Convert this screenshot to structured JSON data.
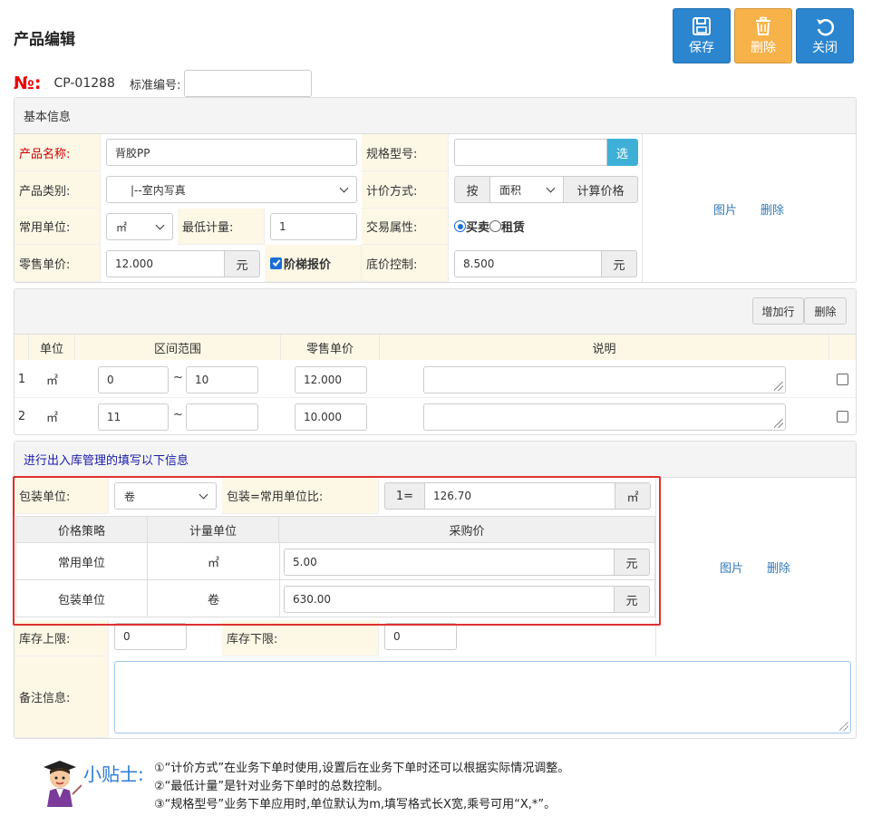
{
  "page": {
    "title": "产品编辑"
  },
  "toolbar": {
    "save": "保存",
    "delete": "删除",
    "close": "关闭",
    "colors": {
      "save": "#2b85cf",
      "delete": "#f7b24a",
      "close": "#2b85cf"
    }
  },
  "header": {
    "no_symbol": "№:",
    "no_value": "CP-01288",
    "std_label": "标准编号:",
    "std_value": ""
  },
  "basic": {
    "title": "基本信息",
    "name_label": "产品名称:",
    "name_value": "背胶PP",
    "spec_label": "规格型号:",
    "spec_value": "",
    "spec_btn": "选",
    "category_label": "产品类别:",
    "category_value": "|--室内写真",
    "pricing_label": "计价方式:",
    "pricing_prefix": "按",
    "pricing_value": "面积",
    "pricing_btn": "计算价格",
    "unit_label": "常用单位:",
    "unit_value": "㎡",
    "min_label": "最低计量:",
    "min_value": "1",
    "trade_label": "交易属性:",
    "trade_opt1": "买卖",
    "trade_opt2": "租赁",
    "retail_label": "零售单价:",
    "retail_value": "12.000",
    "retail_unit": "元",
    "tier_label": "阶梯报价",
    "floor_label": "底价控制:",
    "floor_value": "8.500",
    "floor_unit": "元",
    "image_link": "图片",
    "delete_link": "删除"
  },
  "tier": {
    "add_row": "增加行",
    "delete": "删除",
    "headers": {
      "unit": "单位",
      "range": "区间范围",
      "price": "零售单价",
      "desc": "说明"
    },
    "tilde": "~",
    "rows": [
      {
        "idx": "1",
        "unit": "㎡",
        "from": "0",
        "to": "10",
        "price": "12.000",
        "desc": ""
      },
      {
        "idx": "2",
        "unit": "㎡",
        "from": "11",
        "to": "",
        "price": "10.000",
        "desc": ""
      }
    ]
  },
  "stock": {
    "title": "进行出入库管理的填写以下信息",
    "pack_label": "包装单位:",
    "pack_value": "卷",
    "ratio_label": "包装=常用单位比:",
    "ratio_prefix": "1=",
    "ratio_value": "126.70",
    "ratio_unit": "㎡",
    "headers": {
      "strategy": "价格策略",
      "unit": "计量单位",
      "cost": "采购价"
    },
    "rows": [
      {
        "strategy": "常用单位",
        "unit": "㎡",
        "cost": "5.00",
        "currency": "元"
      },
      {
        "strategy": "包装单位",
        "unit": "卷",
        "cost": "630.00",
        "currency": "元"
      }
    ],
    "max_label": "库存上限:",
    "max_value": "0",
    "min_label": "库存下限:",
    "min_value": "0",
    "remark_label": "备注信息:",
    "remark_value": "",
    "image_link": "图片",
    "delete_link": "删除"
  },
  "tips": {
    "title": "小贴士:",
    "line1": "①“计价方式”在业务下单时使用,设置后在业务下单时还可以根据实际情况调整。",
    "line2": "②“最低计量”是针对业务下单时的总数控制。",
    "line3": "③“规格型号”业务下单应用时,单位默认为m,填写格式长X宽,乘号可用“X,*”。"
  }
}
